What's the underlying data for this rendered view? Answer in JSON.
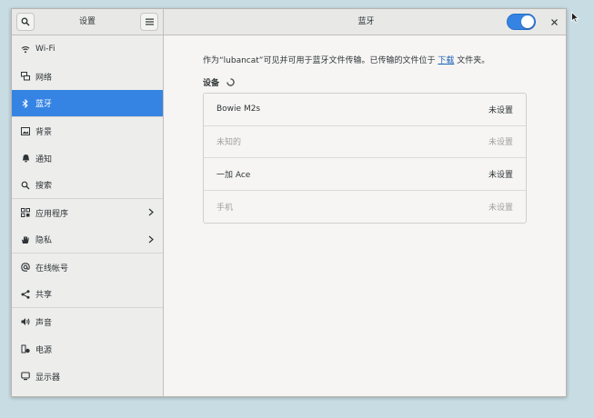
{
  "header": {
    "sidebar_title": "设置",
    "panel_title": "蓝牙",
    "bluetooth_enabled": true
  },
  "sidebar": {
    "items": [
      {
        "label": "Wi-Fi",
        "icon": "wifi-icon"
      },
      {
        "label": "网络",
        "icon": "network-icon"
      },
      {
        "label": "蓝牙",
        "icon": "bluetooth-icon",
        "active": true
      },
      {
        "label": "背景",
        "icon": "background-icon"
      },
      {
        "label": "通知",
        "icon": "bell-icon"
      },
      {
        "label": "搜索",
        "icon": "search-icon"
      },
      {
        "label": "应用程序",
        "icon": "apps-icon",
        "chevron": true
      },
      {
        "label": "隐私",
        "icon": "hand-icon",
        "chevron": true
      },
      {
        "label": "在线帐号",
        "icon": "at-icon"
      },
      {
        "label": "共享",
        "icon": "share-icon"
      },
      {
        "label": "声音",
        "icon": "speaker-icon"
      },
      {
        "label": "电源",
        "icon": "power-icon"
      },
      {
        "label": "显示器",
        "icon": "display-icon"
      }
    ]
  },
  "main": {
    "description_before": "作为“lubancat”可见并可用于蓝牙文件传输。已传输的文件位于",
    "description_link": "下载",
    "description_after": "文件夹。",
    "devices_title": "设备",
    "devices": [
      {
        "name": "Bowie M2s",
        "status": "未设置",
        "dim": false
      },
      {
        "name": "未知的",
        "status": "未设置",
        "dim": true
      },
      {
        "name": "一加 Ace",
        "status": "未设置",
        "dim": false
      },
      {
        "name": "手机",
        "status": "未设置",
        "dim": true
      }
    ]
  },
  "colors": {
    "accent": "#3584e4",
    "link": "#1a5fb4"
  }
}
